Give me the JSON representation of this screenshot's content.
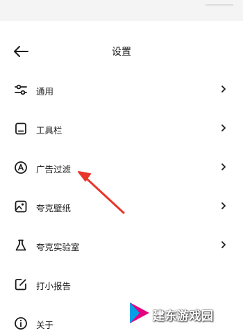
{
  "header": {
    "title": "设置",
    "back_icon": "arrow-left-icon"
  },
  "menu": {
    "items": [
      {
        "label": "通用",
        "icon": "sliders-icon",
        "has_chevron": true
      },
      {
        "label": "工具栏",
        "icon": "toolbar-icon",
        "has_chevron": true
      },
      {
        "label": "广告过滤",
        "icon": "ad-block-icon",
        "has_chevron": true
      },
      {
        "label": "夸克壁纸",
        "icon": "wallpaper-icon",
        "has_chevron": true
      },
      {
        "label": "夸克实验室",
        "icon": "flask-icon",
        "has_chevron": true
      },
      {
        "label": "打小报告",
        "icon": "edit-report-icon",
        "has_chevron": false
      },
      {
        "label": "关于",
        "icon": "info-icon",
        "has_chevron": false
      }
    ]
  },
  "annotation": {
    "arrow_color": "#e8362b",
    "points_to": "广告过滤"
  },
  "watermark": {
    "text": "建东游戏园",
    "colors": [
      "#e4007f",
      "#00a0e9"
    ]
  }
}
